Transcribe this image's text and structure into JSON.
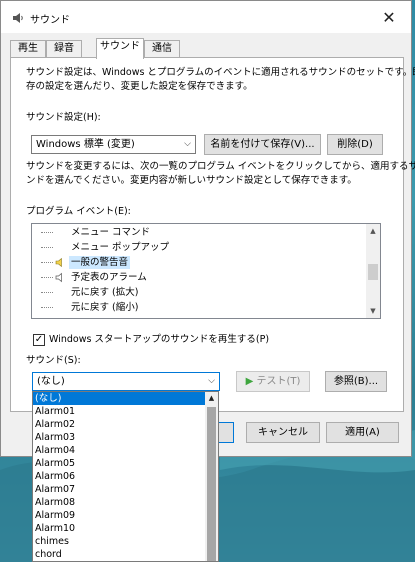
{
  "window": {
    "title": "サウンド",
    "close_glyph": "✕"
  },
  "tabs": [
    "再生",
    "録音",
    "サウンド",
    "通信"
  ],
  "active_tab": "サウンド",
  "intro_text_line1": "サウンド設定は、Windows とプログラムのイベントに適用されるサウンドのセットです。既",
  "intro_text_line2": "存の設定を選んだり、変更した設定を保存できます。",
  "scheme": {
    "label": "サウンド設定(H):",
    "value": "Windows 標準 (変更)",
    "save_as_label": "名前を付けて保存(V)...",
    "delete_label": "削除(D)"
  },
  "change_text_line1": "サウンドを変更するには、次の一覧のプログラム イベントをクリックしてから、適用するサウ",
  "change_text_line2": "ンドを選んでください。変更内容が新しいサウンド設定として保存できます。",
  "events": {
    "label": "プログラム イベント(E):",
    "items": [
      {
        "label": "メニュー コマンド",
        "icon": "none"
      },
      {
        "label": "メニュー ポップアップ",
        "icon": "none"
      },
      {
        "label": "一般の警告音",
        "icon": "speaker-icon",
        "selected": true
      },
      {
        "label": "予定表のアラーム",
        "icon": "speaker-icon"
      },
      {
        "label": "元に戻す (拡大)",
        "icon": "none"
      },
      {
        "label": "元に戻す (縮小)",
        "icon": "none"
      }
    ]
  },
  "startup_checkbox": {
    "label": "Windows スタートアップのサウンドを再生する(P)",
    "checked": true,
    "glyph": "✓"
  },
  "sounds": {
    "label": "サウンド(S):",
    "value": "(なし)",
    "test_label": "テスト(T)",
    "browse_label": "参照(B)...",
    "test_glyph": "▶",
    "options": [
      "(なし)",
      "Alarm01",
      "Alarm02",
      "Alarm03",
      "Alarm04",
      "Alarm05",
      "Alarm06",
      "Alarm07",
      "Alarm08",
      "Alarm09",
      "Alarm10",
      "chimes",
      "chord"
    ]
  },
  "footer": {
    "cancel_label": "キャンセル",
    "apply_label": "適用(A)"
  },
  "colors": {
    "accent": "#0078d7",
    "selection": "#cce8ff",
    "window_bg": "#f0f0f0"
  }
}
